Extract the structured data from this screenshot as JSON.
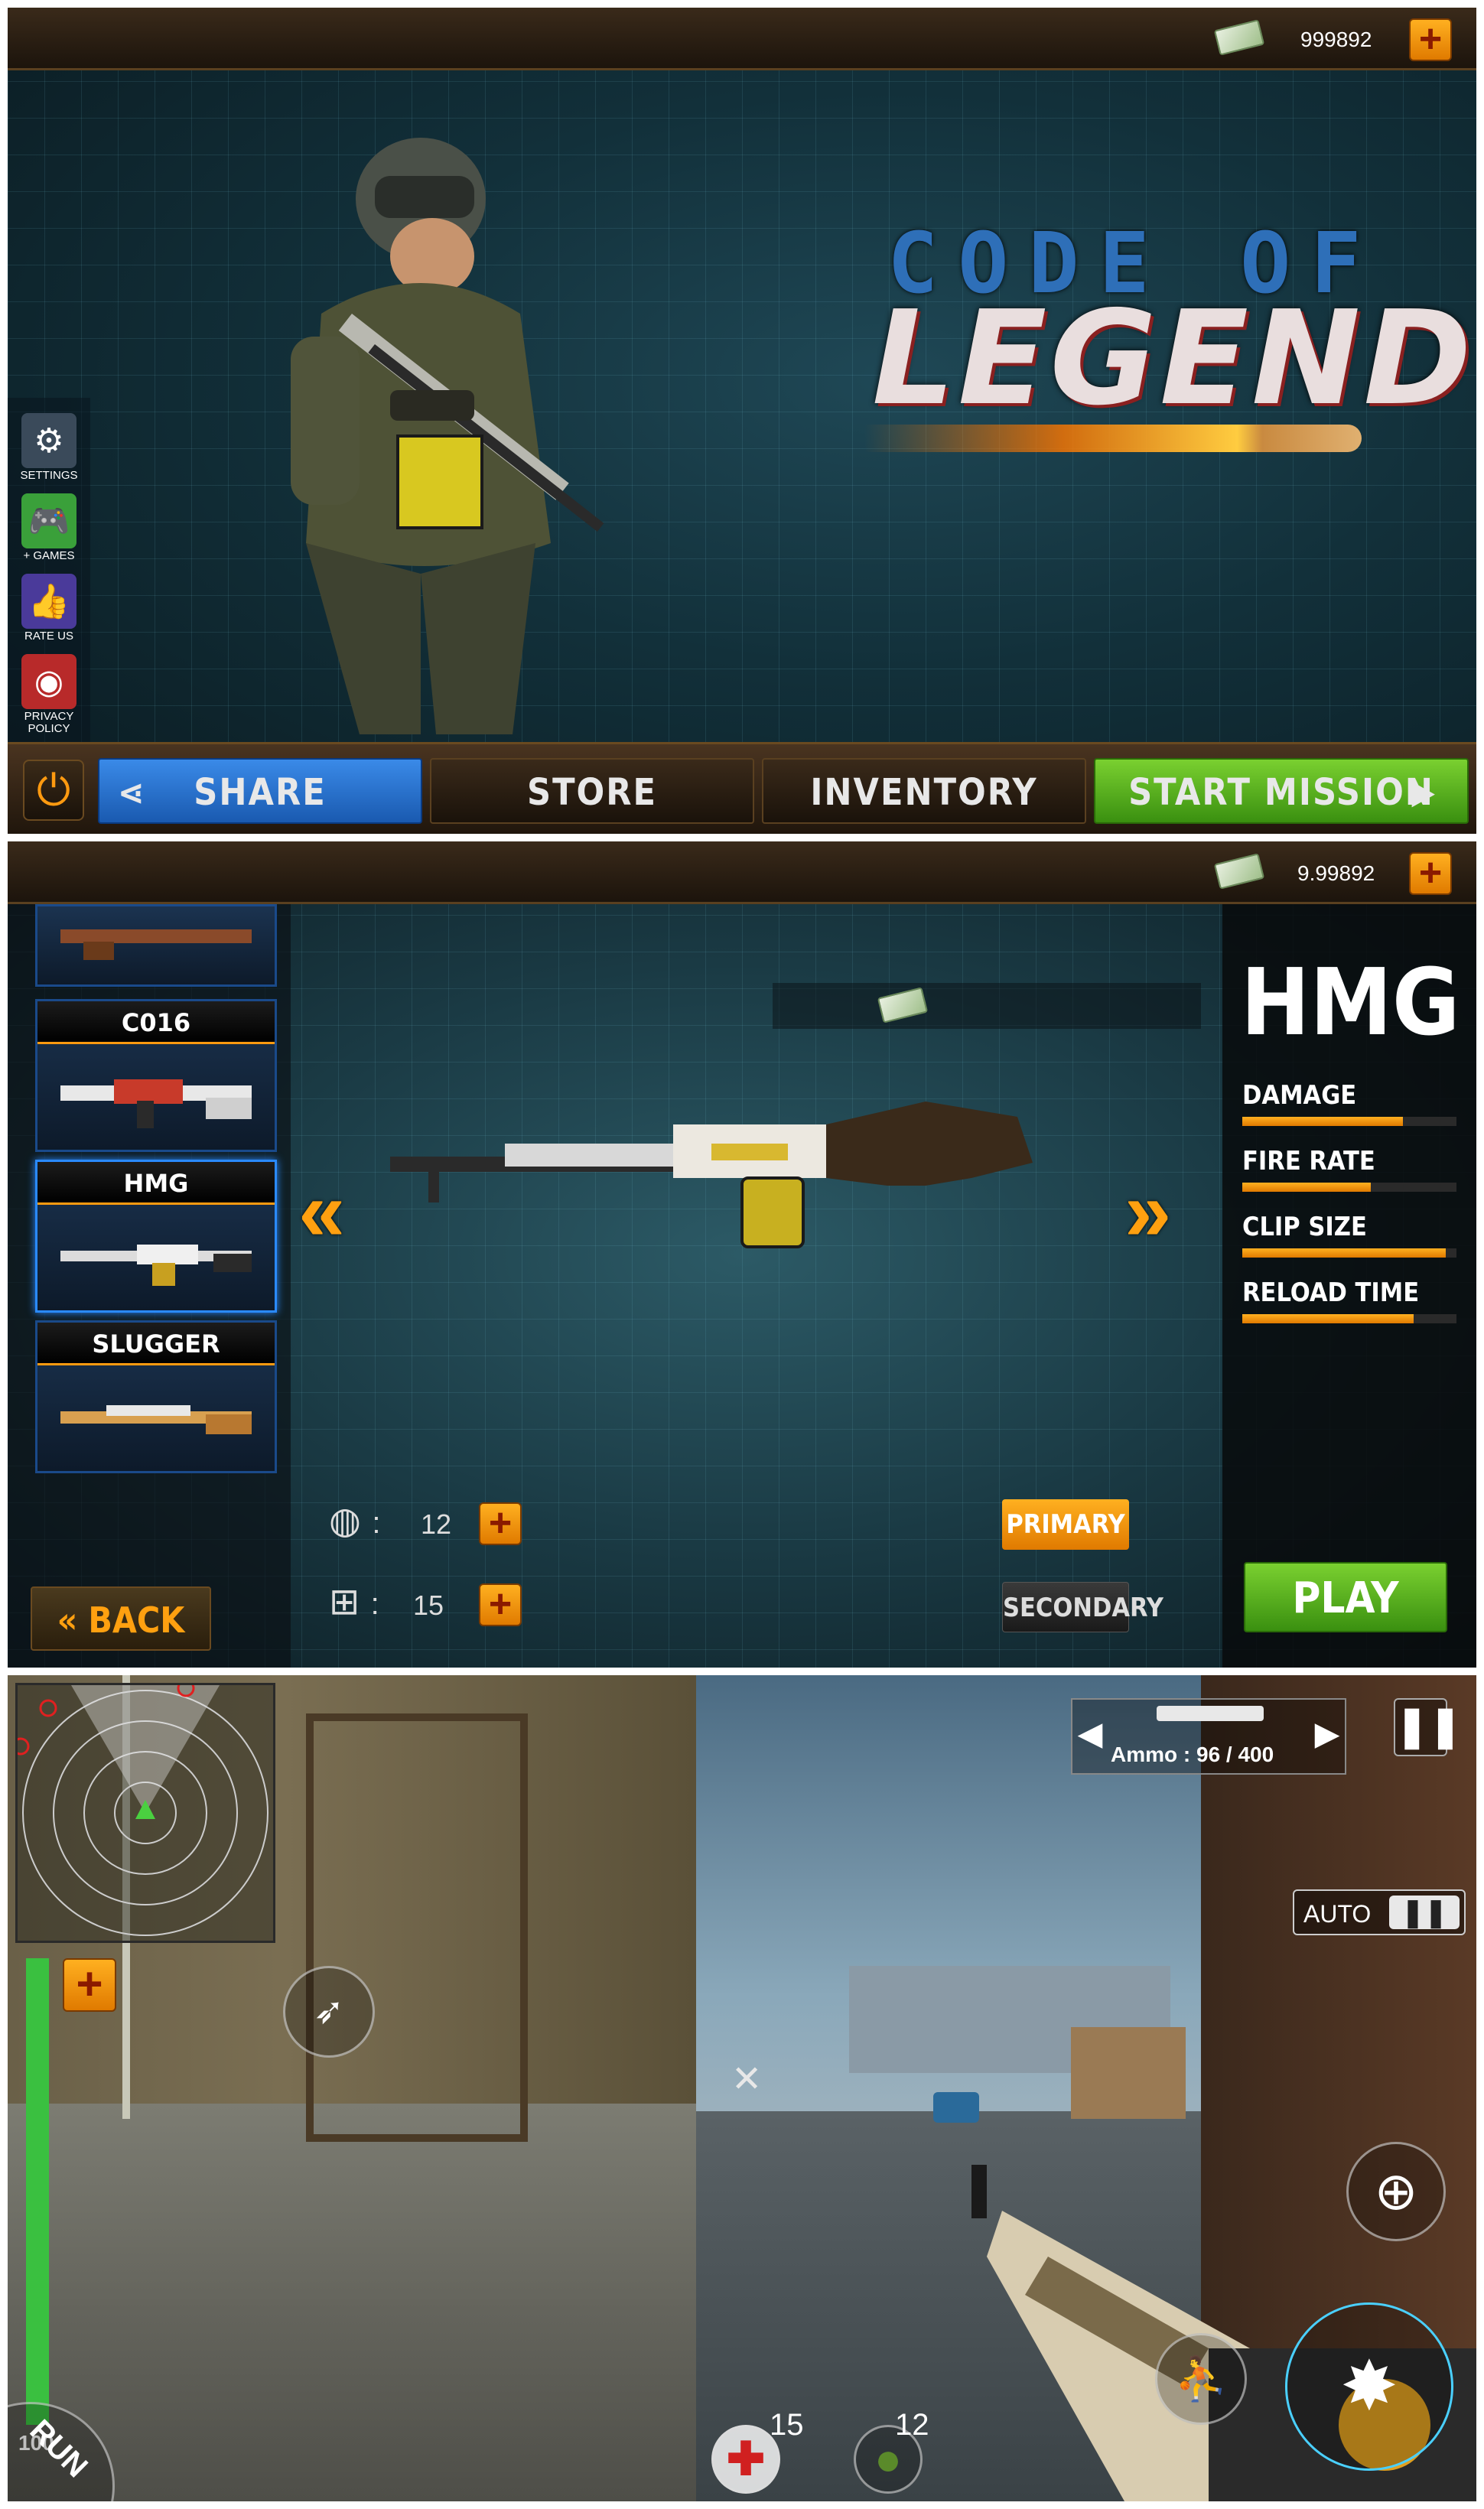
{
  "panel1": {
    "money": "999892",
    "title_line1": "CODE OF",
    "title_line2": "LEGEND",
    "side_menu": [
      {
        "label": "SETTINGS",
        "icon": "gear-icon"
      },
      {
        "label": "+ GAMES",
        "icon": "gamepad-icon"
      },
      {
        "label": "RATE US",
        "icon": "thumbs-up-icon"
      },
      {
        "label": "PRIVACY POLICY",
        "icon": "privacy-eye-icon"
      }
    ],
    "buttons": {
      "share": "SHARE",
      "store": "STORE",
      "inventory": "INVENTORY",
      "start_mission": "START MISSION"
    }
  },
  "panel2": {
    "money": "9.99892",
    "weapons": [
      {
        "name": "C016"
      },
      {
        "name": "HMG"
      },
      {
        "name": "SLUGGER"
      }
    ],
    "selected_weapon": "HMG",
    "stats": [
      {
        "label": "DAMAGE",
        "value": 0.75
      },
      {
        "label": "FIRE RATE",
        "value": 0.6
      },
      {
        "label": "CLIP SIZE",
        "value": 0.95
      },
      {
        "label": "RELOAD TIME",
        "value": 0.8
      }
    ],
    "grenade_count": "12",
    "medkit_count": "15",
    "primary": "PRIMARY",
    "secondary": "SECONDARY",
    "back": "BACK",
    "play": "PLAY"
  },
  "panel3": {
    "ammo": "Ammo : 96 / 400",
    "fire_mode": "AUTO",
    "health": "100",
    "health_level": 1.0,
    "run": "RUN",
    "medkit_count": "15",
    "grenade_count": "12"
  },
  "colors": {
    "accent_orange": "#ff9a10",
    "share_blue": "#2a7ad8",
    "start_green": "#5ab020",
    "health_green": "#3ac040"
  }
}
